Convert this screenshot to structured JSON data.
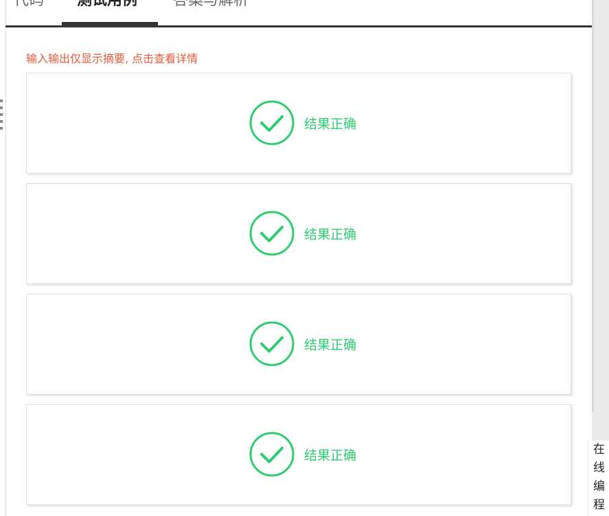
{
  "tabs": {
    "code": "代码",
    "tests": "测试用例",
    "answer": "答案与解析"
  },
  "hint": "输入输出仅显示摘要, 点击查看详情",
  "test_cases": [
    {
      "status": "结果正确",
      "icon": "check-circle-icon"
    },
    {
      "status": "结果正确",
      "icon": "check-circle-icon"
    },
    {
      "status": "结果正确",
      "icon": "check-circle-icon"
    },
    {
      "status": "结果正确",
      "icon": "check-circle-icon"
    }
  ],
  "float_button": {
    "chars": [
      "在",
      "线",
      "编",
      "程"
    ]
  },
  "colors": {
    "success": "#2ecc71",
    "hint": "#e55a3c",
    "tab_active": "#333333"
  }
}
